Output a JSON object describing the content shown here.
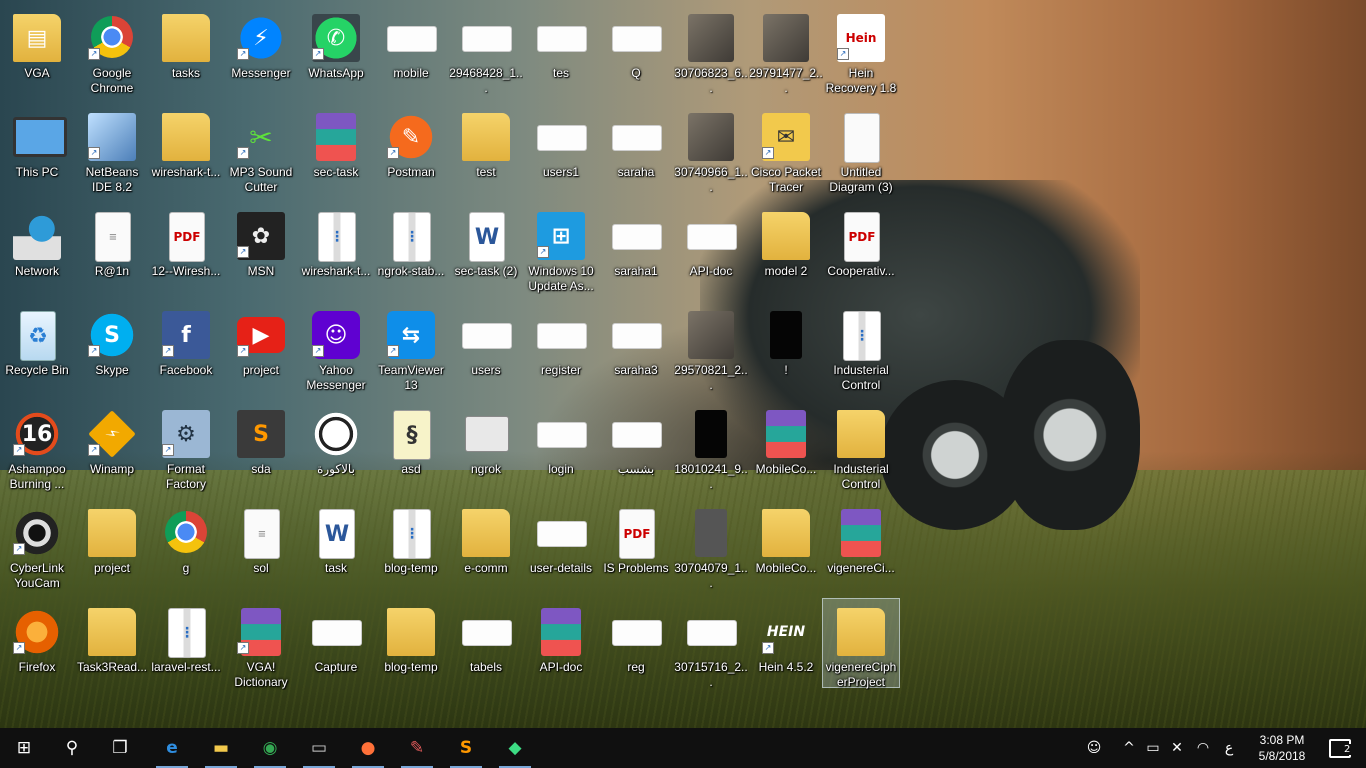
{
  "desktop": {
    "columns": [
      [
        {
          "label": "VGA",
          "icon": "folder-icon",
          "glyph": "▤",
          "style": "g-folder"
        },
        {
          "label": "This PC",
          "icon": "computer-icon",
          "glyph": "",
          "style": "g-pc"
        },
        {
          "label": "Network",
          "icon": "network-icon",
          "glyph": "",
          "style": "g-net"
        },
        {
          "label": "Recycle Bin",
          "icon": "recycle-bin-icon",
          "glyph": "♻",
          "style": "g-recycle"
        },
        {
          "label": "Ashampoo Burning ...",
          "icon": "ashampoo-icon",
          "glyph": "16",
          "style": "g-ash",
          "shortcut": true
        },
        {
          "label": "CyberLink YouCam",
          "icon": "webcam-icon",
          "glyph": "",
          "style": "g-cyber",
          "shortcut": true
        },
        {
          "label": "Firefox",
          "icon": "firefox-icon",
          "glyph": "",
          "style": "g-ff",
          "shortcut": true
        }
      ],
      [
        {
          "label": "Google Chrome",
          "icon": "chrome-icon",
          "glyph": "",
          "style": "g-chrome",
          "shortcut": true
        },
        {
          "label": "NetBeans IDE 8.2",
          "icon": "netbeans-icon",
          "glyph": "",
          "style": "g-cube",
          "shortcut": true
        },
        {
          "label": "R@1n",
          "icon": "text-document-icon",
          "glyph": "≡",
          "style": "g-doc"
        },
        {
          "label": "Skype",
          "icon": "skype-icon",
          "glyph": "S",
          "style": "g-skype",
          "shortcut": true
        },
        {
          "label": "Winamp",
          "icon": "winamp-icon",
          "glyph": "⚡",
          "style": "g-winamp",
          "shortcut": true
        },
        {
          "label": "project",
          "icon": "folder-icon",
          "glyph": "",
          "style": "g-folder"
        },
        {
          "label": "Task3Read...",
          "icon": "folder-icon",
          "glyph": "",
          "style": "g-folder"
        }
      ],
      [
        {
          "label": "tasks",
          "icon": "folder-icon",
          "glyph": "",
          "style": "g-folder"
        },
        {
          "label": "wireshark-t...",
          "icon": "folder-icon",
          "glyph": "",
          "style": "g-folder"
        },
        {
          "label": "12--Wiresh...",
          "icon": "pdf-icon",
          "glyph": "PDF",
          "style": "g-pdf"
        },
        {
          "label": "Facebook",
          "icon": "facebook-icon",
          "glyph": "f",
          "style": "g-fb",
          "shortcut": true
        },
        {
          "label": "Format Factory",
          "icon": "format-factory-icon",
          "glyph": "⚙",
          "style": "g-format",
          "shortcut": true
        },
        {
          "label": "g",
          "icon": "chrome-icon",
          "glyph": "",
          "style": "g-chrome"
        },
        {
          "label": "laravel-rest...",
          "icon": "zip-archive-icon",
          "glyph": "⋮",
          "style": "g-zip"
        }
      ],
      [
        {
          "label": "Messenger",
          "icon": "messenger-icon",
          "glyph": "⚡",
          "style": "g-msg",
          "shortcut": true
        },
        {
          "label": "MP3 Sound Cutter",
          "icon": "scissors-icon",
          "glyph": "✂",
          "style": "g-green",
          "shortcut": true
        },
        {
          "label": "MSN",
          "icon": "msn-icon",
          "glyph": "✿",
          "style": "g-msn",
          "shortcut": true
        },
        {
          "label": "project",
          "icon": "youtube-icon",
          "glyph": "▶",
          "style": "g-yt",
          "shortcut": true
        },
        {
          "label": "sda",
          "icon": "sublime-icon",
          "glyph": "S",
          "style": "g-sub"
        },
        {
          "label": "sol",
          "icon": "text-document-icon",
          "glyph": "≡",
          "style": "g-doc"
        },
        {
          "label": "VGA! Dictionary",
          "icon": "books-icon",
          "glyph": "",
          "style": "g-books",
          "shortcut": true
        }
      ],
      [
        {
          "label": "WhatsApp",
          "icon": "whatsapp-icon",
          "glyph": "✆",
          "style": "g-wa",
          "shortcut": true
        },
        {
          "label": "sec-task",
          "icon": "rar-archive-icon",
          "glyph": "",
          "style": "g-books"
        },
        {
          "label": "wireshark-t...",
          "icon": "zip-archive-icon",
          "glyph": "⋮",
          "style": "g-zip"
        },
        {
          "label": "Yahoo Messenger",
          "icon": "yahoo-messenger-icon",
          "glyph": "☺",
          "style": "g-yahoo",
          "shortcut": true
        },
        {
          "label": "بالاكورة",
          "icon": "soccer-ball-icon",
          "glyph": "",
          "style": "g-ball"
        },
        {
          "label": "task",
          "icon": "word-document-icon",
          "glyph": "W",
          "style": "g-word"
        },
        {
          "label": "Capture",
          "icon": "image-file-icon",
          "glyph": "",
          "style": "g-shot"
        }
      ],
      [
        {
          "label": "mobile",
          "icon": "image-file-icon",
          "glyph": "",
          "style": "g-shot"
        },
        {
          "label": "Postman",
          "icon": "postman-icon",
          "glyph": "✎",
          "style": "g-orange",
          "shortcut": true
        },
        {
          "label": "ngrok-stab...",
          "icon": "zip-archive-icon",
          "glyph": "⋮",
          "style": "g-zip"
        },
        {
          "label": "TeamViewer 13",
          "icon": "teamviewer-icon",
          "glyph": "⇆",
          "style": "g-tv",
          "shortcut": true
        },
        {
          "label": "asd",
          "icon": "script-icon",
          "glyph": "§",
          "style": "g-scroll"
        },
        {
          "label": "blog-temp",
          "icon": "zip-archive-icon",
          "glyph": "⋮",
          "style": "g-zip"
        },
        {
          "label": "blog-temp",
          "icon": "folder-icon",
          "glyph": "",
          "style": "g-folder"
        }
      ],
      [
        {
          "label": "29468428_1...",
          "icon": "image-file-icon",
          "glyph": "",
          "style": "g-shot"
        },
        {
          "label": "test",
          "icon": "chrome-folder-icon",
          "glyph": "",
          "style": "g-folder"
        },
        {
          "label": "sec-task (2)",
          "icon": "word-document-icon",
          "glyph": "W",
          "style": "g-word"
        },
        {
          "label": "users",
          "icon": "image-file-icon",
          "glyph": "",
          "style": "g-shot"
        },
        {
          "label": "ngrok",
          "icon": "ngrok-icon",
          "glyph": "",
          "style": "g-ngrok"
        },
        {
          "label": "e-comm",
          "icon": "folder-icon",
          "glyph": "",
          "style": "g-folder"
        },
        {
          "label": "tabels",
          "icon": "image-file-icon",
          "glyph": "",
          "style": "g-shot"
        }
      ],
      [
        {
          "label": "tes",
          "icon": "image-file-icon",
          "glyph": "",
          "style": "g-shot"
        },
        {
          "label": "users1",
          "icon": "image-file-icon",
          "glyph": "",
          "style": "g-shot"
        },
        {
          "label": "Windows 10 Update As...",
          "icon": "windows-icon",
          "glyph": "⊞",
          "style": "g-win10",
          "shortcut": true
        },
        {
          "label": "register",
          "icon": "image-file-icon",
          "glyph": "",
          "style": "g-shot"
        },
        {
          "label": "login",
          "icon": "image-file-icon",
          "glyph": "",
          "style": "g-shot"
        },
        {
          "label": "user-details",
          "icon": "image-file-icon",
          "glyph": "",
          "style": "g-shot"
        },
        {
          "label": "API-doc",
          "icon": "rar-archive-icon",
          "glyph": "",
          "style": "g-books"
        }
      ],
      [
        {
          "label": "Q",
          "icon": "image-file-icon",
          "glyph": "",
          "style": "g-shot"
        },
        {
          "label": "saraha",
          "icon": "image-file-icon",
          "glyph": "",
          "style": "g-shot"
        },
        {
          "label": "saraha1",
          "icon": "image-file-icon",
          "glyph": "",
          "style": "g-shot"
        },
        {
          "label": "saraha3",
          "icon": "image-file-icon",
          "glyph": "",
          "style": "g-shot"
        },
        {
          "label": "بشسب",
          "icon": "image-file-icon",
          "glyph": "",
          "style": "g-shot"
        },
        {
          "label": "IS Problems",
          "icon": "pdf-icon",
          "glyph": "PDF",
          "style": "g-pdf"
        },
        {
          "label": "reg",
          "icon": "image-file-icon",
          "glyph": "",
          "style": "g-shot"
        }
      ],
      [
        {
          "label": "30706823_6...",
          "icon": "photo-icon",
          "glyph": "",
          "style": "g-photo"
        },
        {
          "label": "30740966_1...",
          "icon": "photo-icon",
          "glyph": "",
          "style": "g-photo"
        },
        {
          "label": "API-doc",
          "icon": "image-file-icon",
          "glyph": "",
          "style": "g-shot"
        },
        {
          "label": "29570821_2...",
          "icon": "photo-icon",
          "glyph": "",
          "style": "g-photo"
        },
        {
          "label": "18010241_9...",
          "icon": "photo-icon",
          "glyph": "",
          "style": "g-black"
        },
        {
          "label": "30704079_1...",
          "icon": "photo-icon",
          "glyph": "",
          "style": "g-gray"
        },
        {
          "label": "30715716_2...",
          "icon": "image-file-icon",
          "glyph": "",
          "style": "g-shot"
        }
      ],
      [
        {
          "label": "29791477_2...",
          "icon": "photo-icon",
          "glyph": "",
          "style": "g-photo"
        },
        {
          "label": "Cisco Packet Tracer",
          "icon": "packet-tracer-icon",
          "glyph": "✉",
          "style": "g-mail",
          "shortcut": true
        },
        {
          "label": "model 2",
          "icon": "folder-icon",
          "glyph": "",
          "style": "g-folder"
        },
        {
          "label": "!",
          "icon": "image-file-icon",
          "glyph": "",
          "style": "g-black"
        },
        {
          "label": "MobileCo...",
          "icon": "rar-archive-icon",
          "glyph": "",
          "style": "g-books"
        },
        {
          "label": "MobileCo...",
          "icon": "folder-icon",
          "glyph": "",
          "style": "g-folder"
        },
        {
          "label": "Hein 4.5.2",
          "icon": "hein-icon",
          "glyph": "HEIN",
          "style": "g-hein2",
          "shortcut": true
        }
      ],
      [
        {
          "label": "Hein Recovery 1.8",
          "icon": "hein-recovery-icon",
          "glyph": "Hein",
          "style": "g-hein",
          "shortcut": true
        },
        {
          "label": "Untitled Diagram (3)",
          "icon": "blank-document-icon",
          "glyph": "",
          "style": "g-doc"
        },
        {
          "label": "Cooperativ...",
          "icon": "pdf-icon",
          "glyph": "PDF",
          "style": "g-pdf"
        },
        {
          "label": "Industerial Control",
          "icon": "zip-archive-icon",
          "glyph": "⋮",
          "style": "g-zip"
        },
        {
          "label": "Industerial Control",
          "icon": "folder-icon",
          "glyph": "",
          "style": "g-folder"
        },
        {
          "label": "vigenereCi...",
          "icon": "rar-archive-icon",
          "glyph": "",
          "style": "g-books"
        },
        {
          "label": "vigenereCipherProject",
          "icon": "folder-icon",
          "glyph": "",
          "style": "g-folder",
          "selected": true
        }
      ]
    ]
  },
  "taskbar": {
    "start_glyph": "⊞",
    "search_glyph": "⚲",
    "taskview_glyph": "❐",
    "pinned": [
      {
        "name": "edge-icon",
        "glyph": "e",
        "color": "#2f8ee0"
      },
      {
        "name": "file-explorer-icon",
        "glyph": "▬",
        "color": "#f2c94c"
      },
      {
        "name": "chrome-icon",
        "glyph": "◉",
        "color": "#34a853"
      },
      {
        "name": "terminal-icon",
        "glyph": "▭",
        "color": "#cccccc"
      },
      {
        "name": "firefox-icon",
        "glyph": "●",
        "color": "#ff7139"
      },
      {
        "name": "paint-icon",
        "glyph": "✎",
        "color": "#e05a5a"
      },
      {
        "name": "sublime-icon",
        "glyph": "S",
        "color": "#ff9800"
      },
      {
        "name": "android-studio-icon",
        "glyph": "◆",
        "color": "#3ddc84"
      }
    ],
    "tray": {
      "people_glyph": "☺",
      "chevron_glyph": "^",
      "battery_glyph": "▭",
      "volume_glyph": "✕",
      "wifi_glyph": "◠",
      "language": "ع",
      "time": "3:08 PM",
      "date": "5/8/2018",
      "notification_count": "2"
    }
  }
}
